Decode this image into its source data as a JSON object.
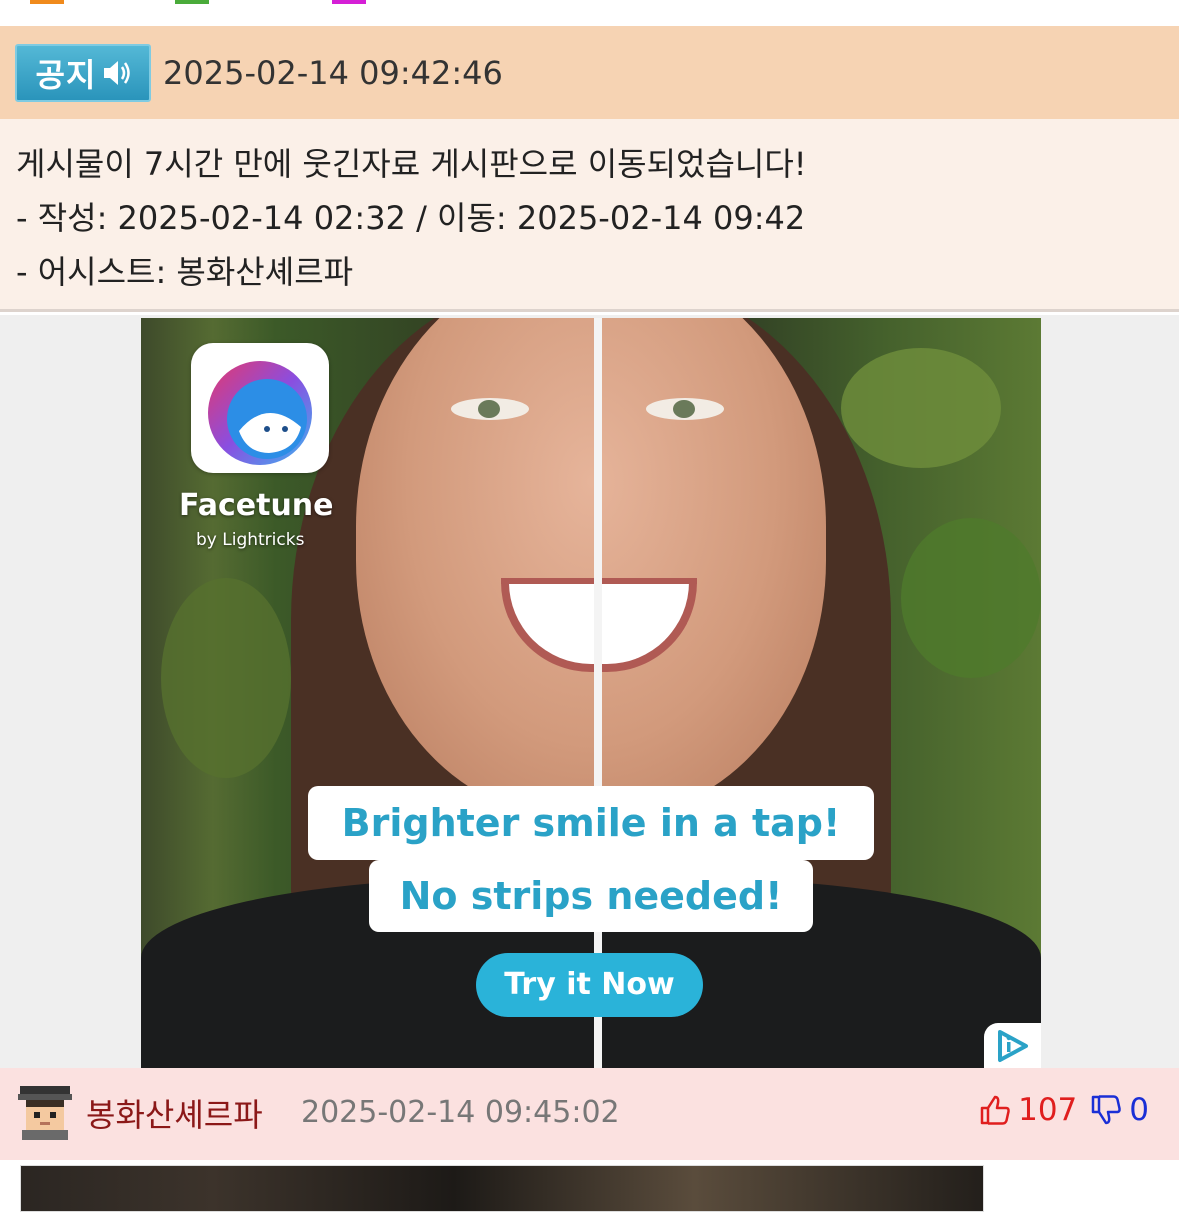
{
  "top_strip": {
    "tab_colors": [
      "#f08a1c",
      "#4aab3a",
      "#d51fd6"
    ]
  },
  "notice": {
    "badge_label": "공지",
    "timestamp": "2025-02-14 09:42:46",
    "line1": "게시물이 7시간 만에 웃긴자료 게시판으로 이동되었습니다!",
    "line2": "- 작성: 2025-02-14 02:32 / 이동: 2025-02-14 09:42",
    "line3": "- 어시스트: 봉화산셰르파",
    "colors": {
      "header_bg": "#f6d3b3",
      "body_bg": "#fbf0e8",
      "badge": "#2a94bb"
    }
  },
  "ad": {
    "brand": "Facetune",
    "brand_sub": "by Lightricks",
    "headline1": "Brighter smile in a tap!",
    "headline2": "No strips needed!",
    "cta": "Try it Now",
    "accent": "#2aa2c7"
  },
  "comment": {
    "username": "봉화산셰르파",
    "timestamp": "2025-02-14 09:45:02",
    "upvotes": "107",
    "downvotes": "0",
    "colors": {
      "row_bg": "#fbe1e0",
      "username": "#8b1818",
      "up": "#e01e1e",
      "down": "#1a2fd6"
    }
  }
}
